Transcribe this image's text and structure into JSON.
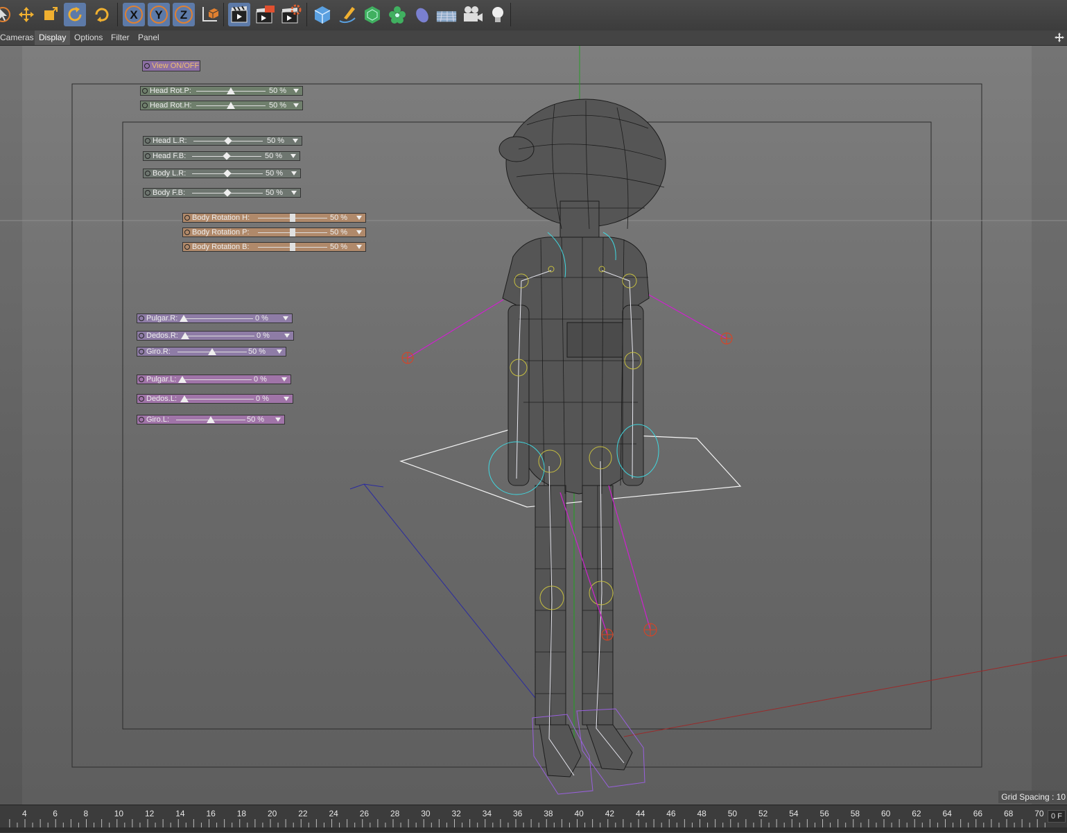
{
  "menubar": {
    "items": [
      "Cameras",
      "Display",
      "Options",
      "Filter",
      "Panel"
    ],
    "active": "Display"
  },
  "toolbar": {
    "tools": [
      "select-tool-icon",
      "move-tool-icon",
      "scale-tool-icon",
      "rotate-tool-icon",
      "recent-rotate-icon"
    ],
    "axes": [
      "X",
      "Y",
      "Z"
    ],
    "coord": "coordinate-system-icon",
    "render": [
      "render-view-icon",
      "render-picture-viewer-icon",
      "render-settings-icon"
    ],
    "objects": [
      "cube-icon",
      "pen-spline-icon",
      "subdivision-icon",
      "mograph-cloner-icon",
      "deformer-icon",
      "floor-icon",
      "camera-icon",
      "light-icon"
    ]
  },
  "viewport": {
    "view_toggle": "View ON/OFF",
    "grid_spacing": "Grid Spacing : 10"
  },
  "head_sliders": [
    {
      "label": "Head Rot.P:",
      "value": "50 %",
      "fraction": 0.5
    },
    {
      "label": "Head Rot.H:",
      "value": "50 %",
      "fraction": 0.5
    }
  ],
  "body_sliders": [
    {
      "label": "Head L.R:",
      "value": "50 %",
      "fraction": 0.5
    },
    {
      "label": "Head F.B:",
      "value": "50 %",
      "fraction": 0.5
    },
    {
      "label": "Body L.R:",
      "value": "50 %",
      "fraction": 0.5
    },
    {
      "label": "Body F.B:",
      "value": "50 %",
      "fraction": 0.5
    }
  ],
  "rotation_sliders": [
    {
      "label": "Body Rotation H:",
      "value": "50 %",
      "fraction": 0.5
    },
    {
      "label": "Body Rotation P:",
      "value": "50 %",
      "fraction": 0.5
    },
    {
      "label": "Body Rotation B:",
      "value": "50 %",
      "fraction": 0.5
    }
  ],
  "hand_sliders": [
    {
      "label": "Pulgar.R:",
      "value": "0 %",
      "fraction": 0.0
    },
    {
      "label": "Dedos.R:",
      "value": "0 %",
      "fraction": 0.0
    },
    {
      "label": "Giro.R:",
      "value": "50 %",
      "fraction": 0.5
    },
    {
      "label": "Pulgar.L:",
      "value": "0 %",
      "fraction": 0.0
    },
    {
      "label": "Dedos.L:",
      "value": "0 %",
      "fraction": 0.0
    },
    {
      "label": "Giro.L:",
      "value": "50 %",
      "fraction": 0.5
    }
  ],
  "timeline": {
    "ticks": [
      "4",
      "6",
      "8",
      "10",
      "12",
      "14",
      "16",
      "18",
      "20",
      "22",
      "24",
      "26",
      "28",
      "30",
      "32",
      "34",
      "36",
      "38",
      "40",
      "42",
      "44",
      "46",
      "48",
      "50",
      "52",
      "54",
      "56",
      "58",
      "60",
      "62",
      "64",
      "66",
      "68",
      "70"
    ],
    "current_frame": "0 F"
  },
  "colors": {
    "head_slider_bg": "#6f7f6c",
    "body_slider_bg": "#6e7670",
    "rotation_slider_bg": "#b0896a",
    "hand_r_slider_bg": "#8e7ca6",
    "hand_l_slider_bg": "#a074a8",
    "toggle_bg": "#8c6fa3",
    "toggle_text": "#f0c070",
    "active_tool": "#5d7aa8"
  }
}
